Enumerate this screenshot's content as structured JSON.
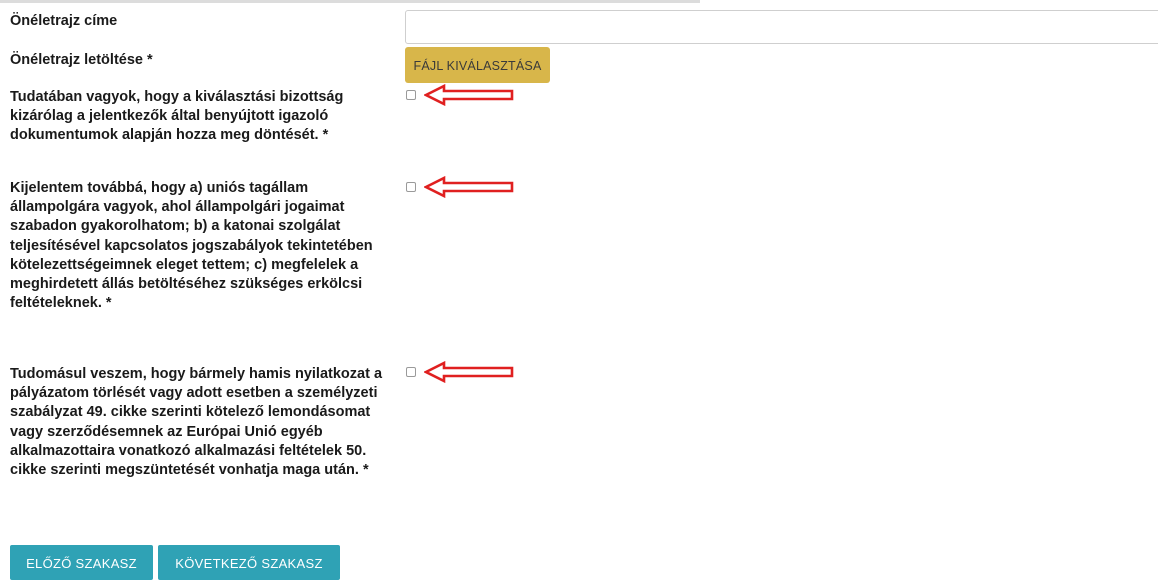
{
  "form": {
    "cv_title_label": "Önéletrajz címe",
    "cv_title_value": "",
    "cv_upload_label": "Önéletrajz letöltése *",
    "file_button_label": "FÁJL KIVÁLASZTÁSA",
    "declarations": [
      {
        "text": "Tudatában vagyok, hogy a kiválasztási bizottság kizárólag a jelentkezők által benyújtott igazoló dokumentumok alapján hozza meg döntését. *",
        "checked": false
      },
      {
        "text": "Kijelentem továbbá, hogy a) uniós tagállam állampolgára vagyok, ahol állampolgári jogaimat szabadon gyakorolhatom; b) a katonai szolgálat teljesítésével kapcsolatos jogszabályok tekintetében kötelezettségeimnek eleget tettem; c) megfelelek a meghirdetett állás betöltéséhez szükséges erkölcsi feltételeknek. *",
        "checked": false
      },
      {
        "text": "Tudomásul veszem, hogy bármely hamis nyilatkozat a pályázatom törlését vagy adott esetben a személyzeti szabályzat 49. cikke szerinti kötelező lemondásomat vagy szerződésemnek az Európai Unió egyéb alkalmazottaira vonatkozó alkalmazási feltételek 50. cikke szerinti megszüntetését vonhatja maga után. *",
        "checked": false
      }
    ]
  },
  "navigation": {
    "prev_label": "ELŐZŐ SZAKASZ",
    "next_label": "KÖVETKEZŐ SZAKASZ"
  },
  "colors": {
    "file_button": "#d8b64a",
    "nav_button": "#2fa2b5",
    "annotation_arrow": "#e02020"
  },
  "icons": {
    "annotation": "red-arrow-icon"
  }
}
